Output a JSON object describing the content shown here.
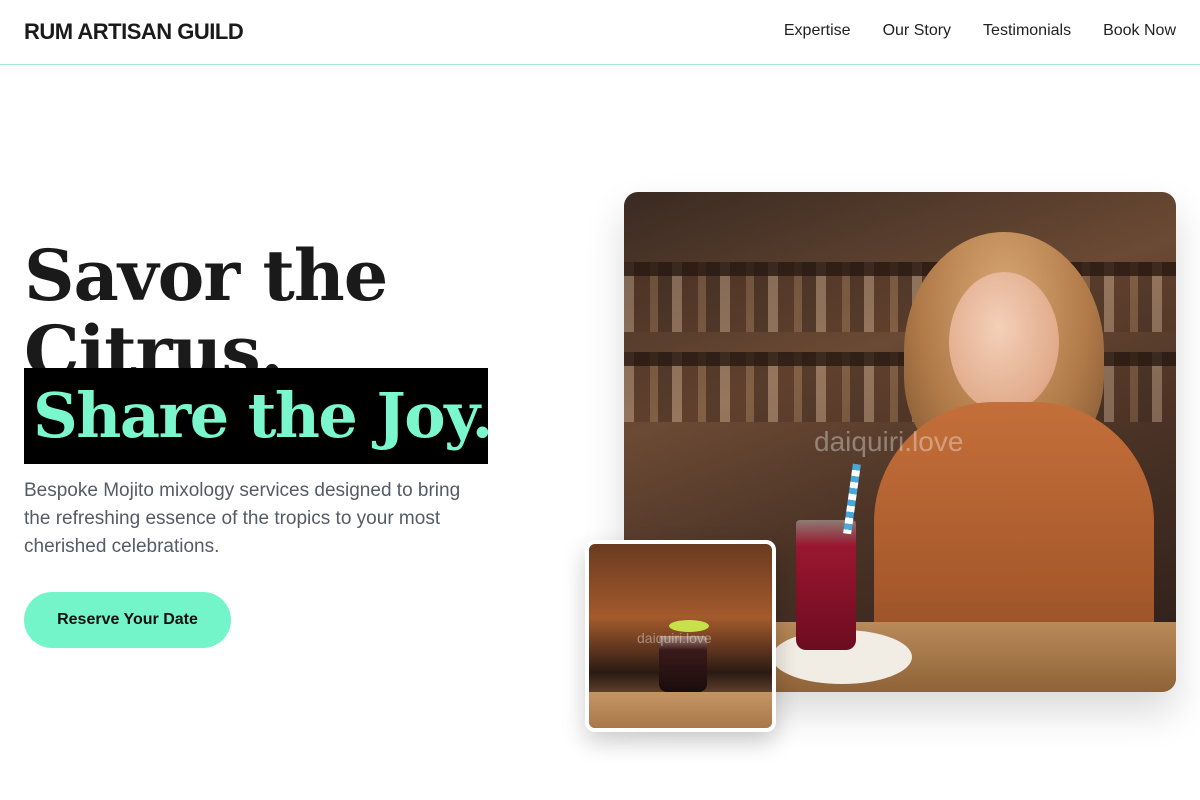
{
  "header": {
    "brand": "RUM ARTISAN GUILD",
    "nav": [
      "Expertise",
      "Our Story",
      "Testimonials",
      "Book Now"
    ]
  },
  "hero": {
    "headline_line1": "Savor the Citrus.",
    "headline_highlight": "Share the Joy.",
    "subcopy": "Bespoke Mojito mixology services designed to bring the refreshing essence of the tropics to your most cherished celebrations.",
    "cta_label": "Reserve Your Date",
    "image_watermark": "daiquiri.love",
    "thumb_watermark": "daiquiri.love"
  },
  "colors": {
    "accent": "#74f5c9",
    "highlight_text": "#7af7cc",
    "highlight_bg": "#000000",
    "header_border": "#a8e8d6"
  }
}
